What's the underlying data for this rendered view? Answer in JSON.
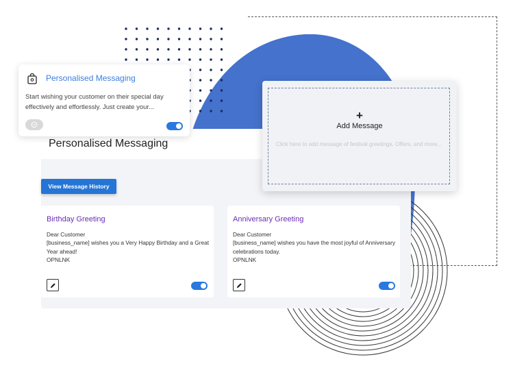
{
  "small_card": {
    "title": "Personalised Messaging",
    "description": "Start wishing your customer on their special day effectively and effortlessly. Just create your...",
    "toggle_on": true
  },
  "main_panel": {
    "title": "Personalised Messaging",
    "history_button": "View Message History"
  },
  "greetings": [
    {
      "title": "Birthday Greeting",
      "lines": [
        "Dear Customer",
        "[business_name] wishes you a Very Happy Birthday and a Great Year ahead!",
        "OPNLNK"
      ],
      "toggle_on": true
    },
    {
      "title": "Anniversary Greeting",
      "lines": [
        "Dear Customer",
        "[business_name] wishes you have the most joyful of Anniversary celebrations today.",
        "OPNLNK"
      ],
      "toggle_on": true
    }
  ],
  "add_message": {
    "plus": "+",
    "label": "Add Message",
    "hint": "Click here to add message of festival greetings, Offers, and more..."
  },
  "colors": {
    "accent_blue": "#2979e0",
    "blob_blue": "#4472cc",
    "greeting_title_purple": "#6b2bb5"
  },
  "icons": [
    "shopping-bag-icon",
    "chat-bubble-icon",
    "pencil-icon"
  ]
}
